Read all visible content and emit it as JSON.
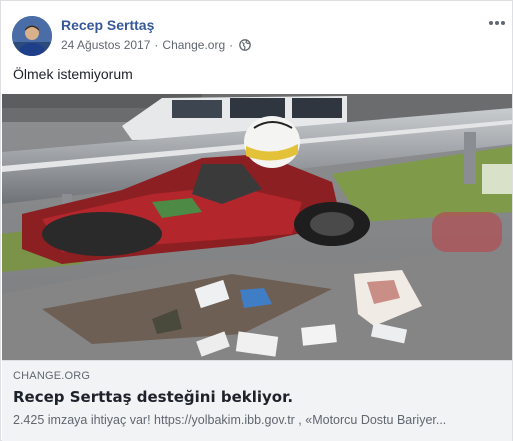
{
  "post": {
    "author": "Recep Serttaş",
    "date": "24 Ağustos 2017",
    "via": "Change.org",
    "separator": "·",
    "text": "Ölmek istemiyorum",
    "icons": {
      "avatar": "profile-photo",
      "privacy": "globe-icon",
      "options": "more-horizontal-icon"
    }
  },
  "link_preview": {
    "source": "CHANGE.ORG",
    "title": "Recep Serttaş desteğini bekliyor.",
    "description": "2.425 imzaya ihtiyaç var! https://yolbakim.ibb.gov.tr , «Motorcu Dostu Bariyer..."
  },
  "colors": {
    "link_blue": "#365899",
    "meta_gray": "#616770",
    "preview_bg": "#f2f3f5"
  }
}
